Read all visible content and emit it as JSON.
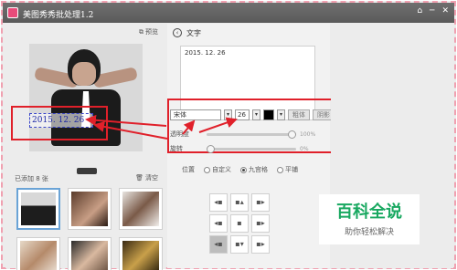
{
  "window": {
    "title": "美图秀秀批处理1.2",
    "controls": [
      "⌂",
      "─",
      "✕"
    ]
  },
  "left": {
    "preview_label": "预览",
    "image_text": "2015. 12. 26",
    "added_label": "已添加 8 张",
    "clear_label": "清空"
  },
  "middle": {
    "section_title": "文字",
    "text_value": "2015. 12. 26",
    "font": {
      "family": "宋体",
      "size": "26",
      "bold_label": "粗体",
      "shadow_label": "阴影"
    },
    "opacity": {
      "label": "透明度",
      "value": "100%",
      "fraction": 1.0
    },
    "rotate": {
      "label": "旋转",
      "value": "0%",
      "fraction": 0.0
    },
    "position": {
      "label": "位置",
      "options": [
        "自定义",
        "九宫格",
        "平铺"
      ],
      "selected": "九宫格"
    },
    "grid_icons": [
      "◂▪",
      "▪▴",
      "▪▸",
      "◂▪",
      "▪",
      "▪▸",
      "◂▪",
      "▪▾",
      "▪▸"
    ]
  },
  "watermark": {
    "main": "百科全说",
    "sub": "助你轻松解决"
  },
  "colors": {
    "accent_red": "#e0202a",
    "text_blue": "#1f2aa6",
    "brand_green": "#18a860"
  }
}
